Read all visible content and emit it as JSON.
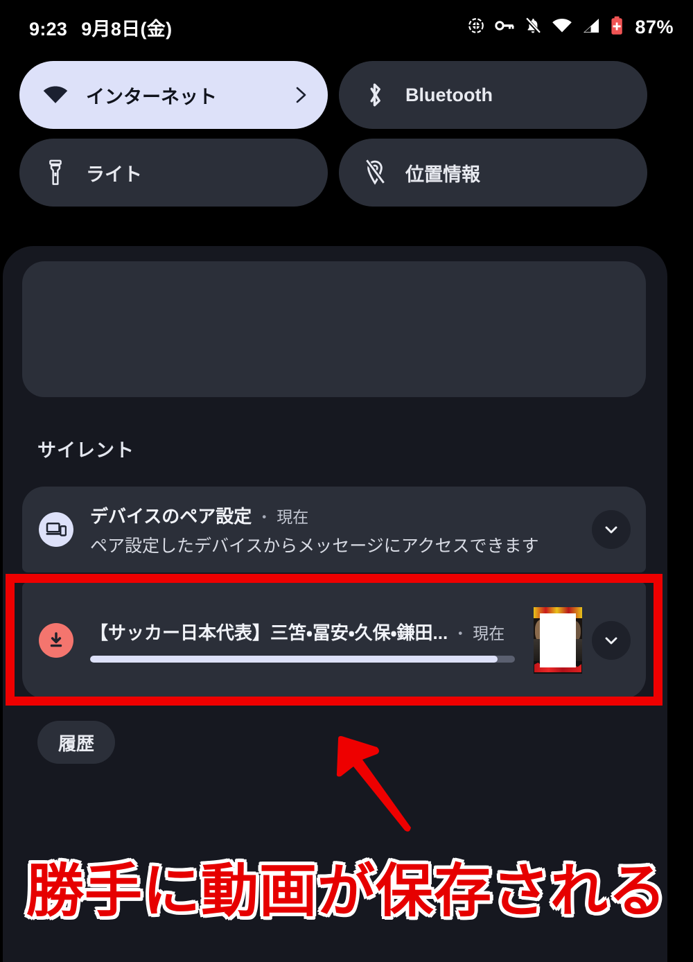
{
  "statusbar": {
    "time": "9:23",
    "date": "9月8日(金)",
    "battery_percent": "87%",
    "icons": [
      {
        "name": "location-active-icon"
      },
      {
        "name": "vpn-key-icon"
      },
      {
        "name": "notifications-off-icon"
      },
      {
        "name": "wifi-icon"
      },
      {
        "name": "cellular-signal-icon"
      },
      {
        "name": "battery-saver-icon"
      }
    ],
    "battery_color": "#f05454"
  },
  "quick_settings": {
    "tiles": [
      {
        "label": "インターネット",
        "icon": "wifi-icon",
        "active": true,
        "has_chevron": true
      },
      {
        "label": "Bluetooth",
        "icon": "bluetooth-icon",
        "active": false,
        "has_chevron": false
      },
      {
        "label": "ライト",
        "icon": "flashlight-icon",
        "active": false,
        "has_chevron": false
      },
      {
        "label": "位置情報",
        "icon": "location-off-icon",
        "active": false,
        "has_chevron": false
      }
    ],
    "active_tile_color": "#dde1f9",
    "inactive_tile_color": "#2b2f39"
  },
  "notifications": {
    "section_label": "サイレント",
    "history_button": "履歴",
    "items": [
      {
        "app_icon": "device-pairing-icon",
        "title": "デバイスのペア設定",
        "separator": "・",
        "time": "現在",
        "text": "ペア設定したデバイスからメッセージにアクセスできます",
        "expand_icon": "chevron-down-icon"
      },
      {
        "app_icon": "download-icon",
        "title": "【サッカー日本代表】三笘・冨安・久保・鎌田...",
        "separator": "・",
        "time": "現在",
        "progress_percent": 96,
        "progress_color": "#dde1f9",
        "thumbnail": "video-thumbnail-redacted",
        "expand_icon": "chevron-down-icon"
      }
    ]
  },
  "annotations": {
    "highlight_color": "#ee0000",
    "arrow": {
      "name": "red-arrow-up-left",
      "color": "#ee0000"
    },
    "caption": "勝手に動画が保存される",
    "caption_color": "#e60000",
    "caption_outline_color": "#ffffff"
  }
}
